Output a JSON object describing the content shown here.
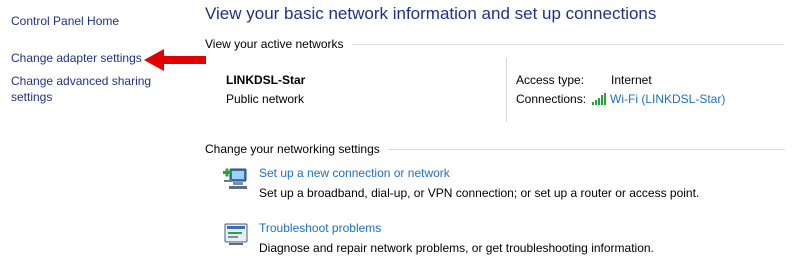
{
  "sidebar": {
    "home": "Control Panel Home",
    "adapter": "Change adapter settings",
    "sharing": "Change advanced sharing settings"
  },
  "main": {
    "title": "View your basic network information and set up connections",
    "active_header": "View your active networks",
    "network": {
      "name": "LINKDSL-Star",
      "type": "Public network",
      "access_type_label": "Access type:",
      "access_type_value": "Internet",
      "connections_label": "Connections:",
      "connections_value": "Wi-Fi (LINKDSL-Star)",
      "connection_icon": "wifi-signal-icon"
    },
    "settings_header": "Change your networking settings",
    "tasks": [
      {
        "icon": "new-connection-icon",
        "link": "Set up a new connection or network",
        "desc": "Set up a broadband, dial-up, or VPN connection; or set up a router or access point."
      },
      {
        "icon": "troubleshoot-icon",
        "link": "Troubleshoot problems",
        "desc": "Diagnose and repair network problems, or get troubleshooting information."
      }
    ]
  },
  "annotation": {
    "icon": "red-arrow-icon",
    "color": "#e30000"
  },
  "colors": {
    "nav_link": "#1e3287",
    "link": "#1e6fc4",
    "rule": "#d9d9d9",
    "wifi": "#22a33a"
  }
}
